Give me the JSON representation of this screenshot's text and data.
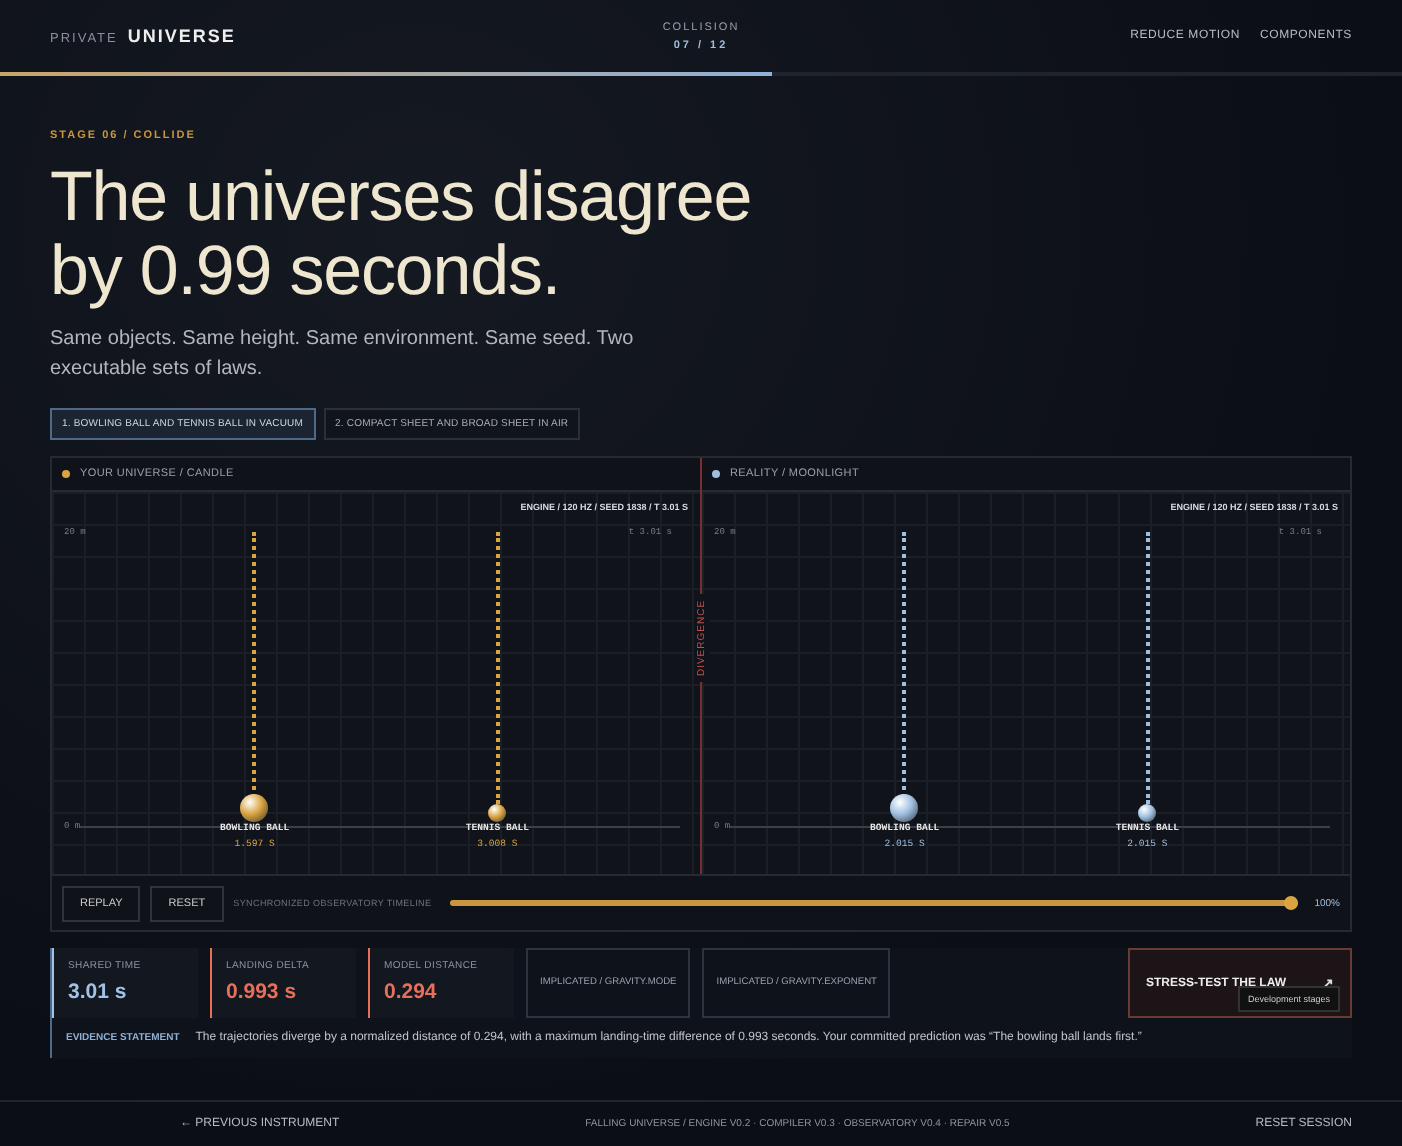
{
  "header": {
    "brand_prefix": "PRIVATE",
    "brand": "UNIVERSE",
    "stage_name": "COLLISION",
    "stage_count": "07 / 12",
    "links": [
      "REDUCE MOTION",
      "COMPONENTS"
    ],
    "progress": {
      "level": 0.55
    }
  },
  "hero": {
    "eyebrow": "STAGE 06 / COLLIDE",
    "title": "The universes disagree by 0.99 seconds.",
    "subtitle": "Same objects. Same height. Same environment. Same seed. Two executable sets of laws."
  },
  "tabs": [
    {
      "label": "1. BOWLING BALL AND TENNIS BALL IN VACUUM",
      "selected": true
    },
    {
      "label": "2. COMPACT SHEET AND BROAD SHEET IN AIR",
      "selected": false
    }
  ],
  "universes": [
    {
      "title": "YOUR UNIVERSE / CANDLE",
      "color": "#d9a441",
      "engine": "ENGINE / 120 HZ / SEED 1838 / T 3.01 S",
      "y_top": "20 m",
      "y_bottom": "0 m",
      "clock": "t 3.01 s",
      "objects": [
        {
          "kind": "heavy",
          "name": "BOWLING BALL",
          "time": "1.597 S"
        },
        {
          "kind": "light",
          "name": "TENNIS BALL",
          "time": "3.008 S"
        }
      ]
    },
    {
      "title": "REALITY / MOONLIGHT",
      "color": "#9fbfe0",
      "engine": "ENGINE / 120 HZ / SEED 1838 / T 3.01 S",
      "y_top": "20 m",
      "y_bottom": "0 m",
      "clock": "t 3.01 s",
      "objects": [
        {
          "kind": "heavy",
          "name": "BOWLING BALL",
          "time": "2.015 S"
        },
        {
          "kind": "light",
          "name": "TENNIS BALL",
          "time": "2.015 S"
        }
      ]
    }
  ],
  "divergence_label": "DIVERGENCE",
  "controls": {
    "buttons": [
      "REPLAY",
      "RESET"
    ],
    "timeline_label": "SYNCHRONIZED OBSERVATORY TIMELINE",
    "timeline": {
      "level": 1.0
    },
    "reading": "100%"
  },
  "metrics": [
    {
      "label": "SHARED TIME",
      "value": "3.01 s",
      "color": "#9fc3e8"
    },
    {
      "label": "LANDING DELTA",
      "value": "0.993 s",
      "color": "#e8705a"
    },
    {
      "label": "MODEL DISTANCE",
      "value": "0.294",
      "color": "#e8705a"
    }
  ],
  "implicated": [
    "IMPLICATED / GRAVITY.MODE",
    "IMPLICATED / GRAVITY.EXPONENT"
  ],
  "stress_button": "STRESS-TEST THE LAW",
  "stress_icon": "↗",
  "tooltip": "Development stages",
  "evidence": {
    "label": "EVIDENCE STATEMENT",
    "text": "The trajectories diverge by a normalized distance of 0.294, with a maximum landing-time difference of 0.993 seconds. Your committed prediction was “The bowling ball lands first.”"
  },
  "footer": {
    "previous": "← PREVIOUS INSTRUMENT",
    "versions": "FALLING UNIVERSE / ENGINE V0.2 · COMPILER V0.3 · OBSERVATORY V0.4 · REPAIR V0.5",
    "reset": "RESET SESSION"
  }
}
